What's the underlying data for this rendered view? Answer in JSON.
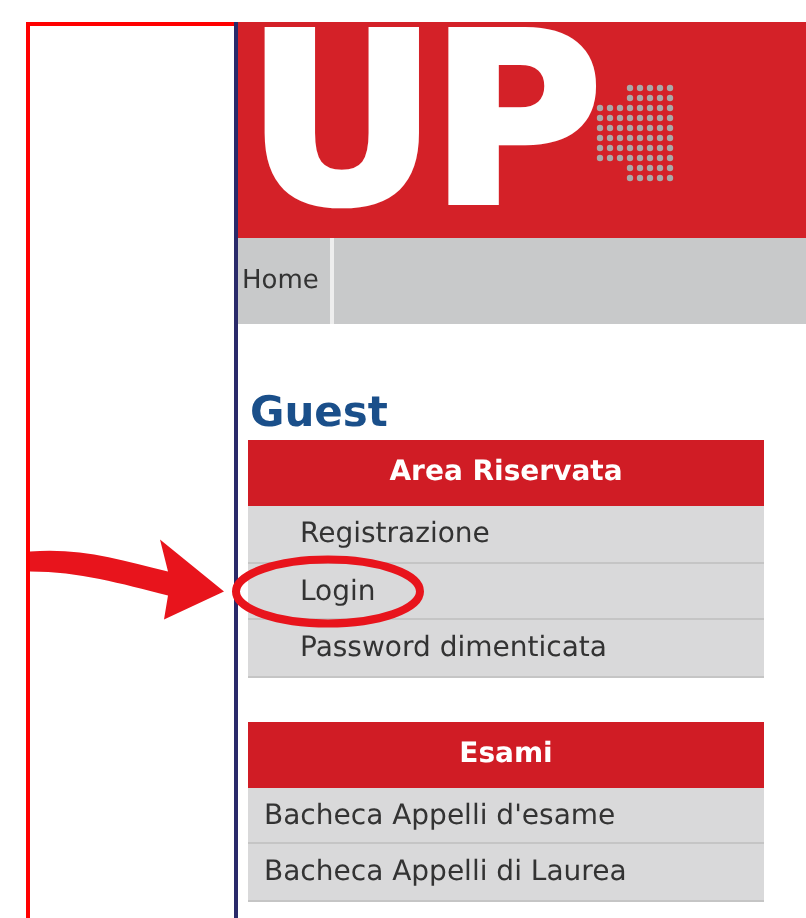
{
  "logo": {
    "text": "UP"
  },
  "nav": [
    {
      "label": "Home"
    }
  ],
  "user": {
    "name": "Guest"
  },
  "menus": [
    {
      "title": "Area Riservata",
      "indent": true,
      "items": [
        "Registrazione",
        "Login",
        "Password dimenticata"
      ]
    },
    {
      "title": "Esami",
      "indent": false,
      "items": [
        "Bacheca Appelli d'esame",
        "Bacheca Appelli di Laurea"
      ]
    }
  ]
}
